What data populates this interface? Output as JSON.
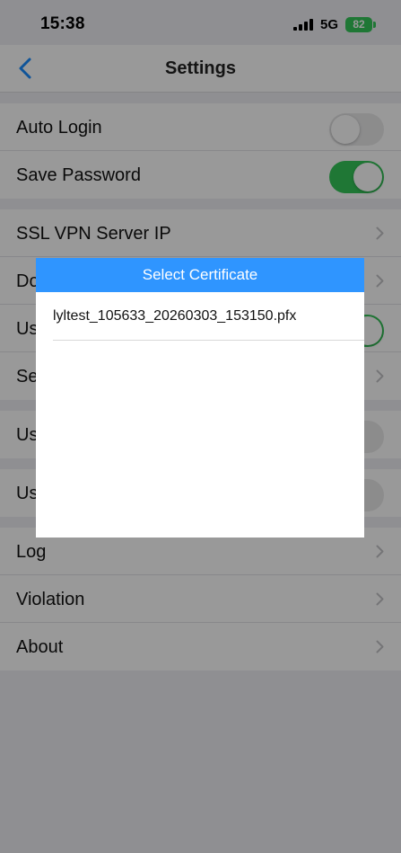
{
  "status_bar": {
    "time": "15:38",
    "network": "5G",
    "battery": "82"
  },
  "nav": {
    "title": "Settings",
    "back_icon": "chevron-left-icon"
  },
  "sections": [
    {
      "rows": [
        {
          "label": "Auto Login",
          "type": "toggle",
          "value": false
        },
        {
          "label": "Save Password",
          "type": "toggle",
          "value": true
        }
      ]
    },
    {
      "rows": [
        {
          "label": "SSL VPN Server IP",
          "type": "link"
        },
        {
          "label": "Do",
          "type": "link"
        },
        {
          "label": "Us",
          "type": "toggle",
          "value": true
        },
        {
          "label": "Se",
          "type": "link"
        }
      ]
    },
    {
      "rows": [
        {
          "label": "Us",
          "type": "toggle",
          "value": false
        }
      ]
    },
    {
      "rows": [
        {
          "label": "Us",
          "type": "toggle",
          "value": false
        }
      ]
    },
    {
      "rows": [
        {
          "label": "Log",
          "type": "link"
        },
        {
          "label": "Violation",
          "type": "link"
        },
        {
          "label": "About",
          "type": "link"
        }
      ]
    }
  ],
  "dialog": {
    "title": "Select Certificate",
    "items": [
      "lyltest_105633_20260303_153150.pfx"
    ]
  },
  "colors": {
    "accent": "#2f95ff",
    "toggle_on": "#34c759",
    "background": "#efeff4"
  }
}
